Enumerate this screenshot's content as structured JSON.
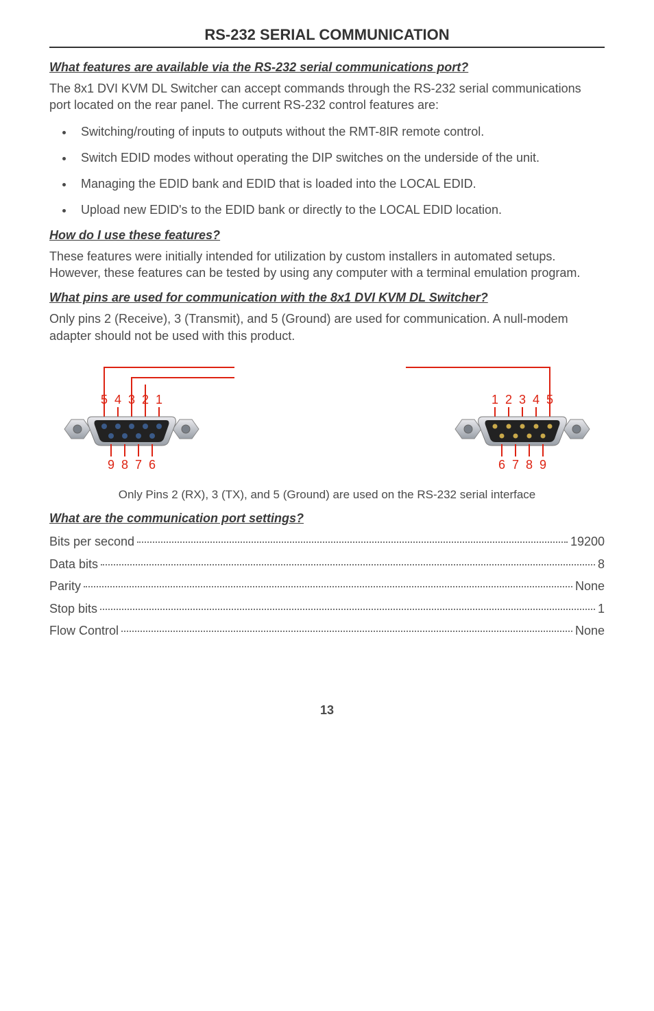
{
  "title": "RS-232 SERIAL COMMUNICATION",
  "section1": {
    "heading": "What features are available via the RS-232 serial communications port?",
    "para": "The 8x1 DVI KVM DL Switcher can accept commands through the RS-232 serial communications port located on the rear panel. The current RS-232 control features are:",
    "items": [
      "Switching/routing of inputs to outputs without the RMT-8IR remote control.",
      "Switch EDID modes without operating the DIP switches on the underside of the unit.",
      "Managing the EDID bank and EDID that is loaded into the LOCAL EDID.",
      "Upload new EDID's to the EDID bank or directly to the LOCAL EDID location."
    ]
  },
  "section2": {
    "heading": "How do I use these features?",
    "para": "These features were initially intended for utilization by custom installers in automated setups. However, these features can be tested by using any computer with a terminal emulation program."
  },
  "section3": {
    "heading": "What pins are used for communication with the 8x1 DVI KVM DL Switcher?",
    "para": "Only pins 2 (Receive), 3 (Transmit), and 5 (Ground) are used for communication. A null-modem adapter should not be used with this product.",
    "caption": "Only Pins 2 (RX), 3 (TX), and 5 (Ground) are used on the RS-232 serial interface"
  },
  "pin_labels_left_top": [
    "5",
    "4",
    "3",
    "2",
    "1"
  ],
  "pin_labels_left_bot": [
    "9",
    "8",
    "7",
    "6"
  ],
  "pin_labels_right_top": [
    "1",
    "2",
    "3",
    "4",
    "5"
  ],
  "pin_labels_right_bot": [
    "6",
    "7",
    "8",
    "9"
  ],
  "section4": {
    "heading": "What are the communication port settings?",
    "rows": [
      {
        "label": "Bits per second",
        "value": "19200"
      },
      {
        "label": "Data bits",
        "value": "8"
      },
      {
        "label": "Parity",
        "value": "None"
      },
      {
        "label": "Stop bits",
        "value": "1"
      },
      {
        "label": "Flow Control",
        "value": "None"
      }
    ]
  },
  "page_number": "13",
  "chart_data": {
    "type": "table",
    "title": "RS-232 Communication Port Settings",
    "rows": [
      {
        "parameter": "Bits per second",
        "value": "19200"
      },
      {
        "parameter": "Data bits",
        "value": "8"
      },
      {
        "parameter": "Parity",
        "value": "None"
      },
      {
        "parameter": "Stop bits",
        "value": "1"
      },
      {
        "parameter": "Flow Control",
        "value": "None"
      }
    ]
  }
}
